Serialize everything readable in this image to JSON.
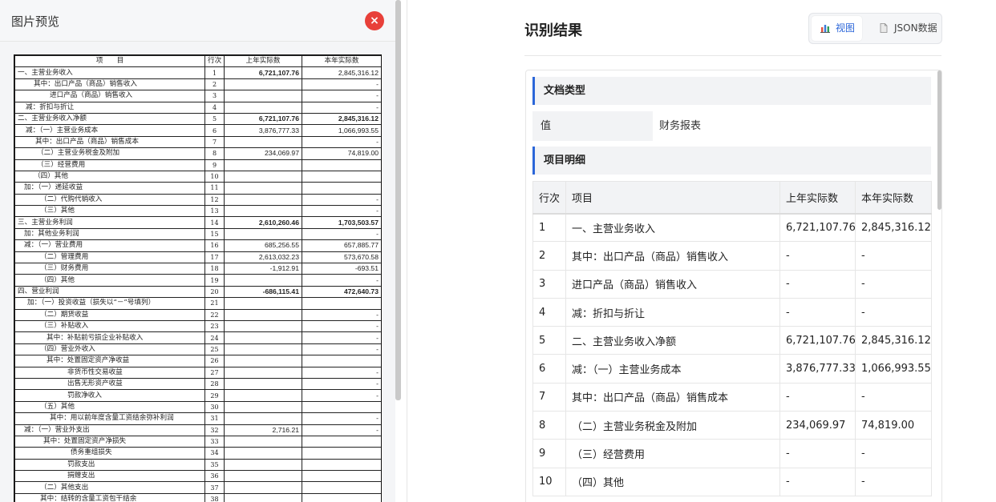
{
  "left": {
    "title": "图片预览",
    "close_glyph": "×"
  },
  "doc": {
    "headers": [
      "项　　目",
      "行次",
      "上年实际数",
      "本年实际数"
    ],
    "rows": [
      {
        "item": "一、主营业务收入",
        "no": "1",
        "prev": "6,721,107.76",
        "cur": "2,845,316.12",
        "bold_prev": true,
        "bold_cur": false,
        "indent": 0
      },
      {
        "item": "其中：出口产品（商品）销售收入",
        "no": "2",
        "prev": "",
        "cur": "-",
        "indent": 20
      },
      {
        "item": "进口产品（商品）销售收入",
        "no": "3",
        "prev": "",
        "cur": "-",
        "indent": 40
      },
      {
        "item": "减：折扣与折让",
        "no": "4",
        "prev": "",
        "cur": "-",
        "indent": 10
      },
      {
        "item": "二、主营业务收入净额",
        "no": "5",
        "prev": "6,721,107.76",
        "cur": "2,845,316.12",
        "bold_prev": true,
        "bold_cur": true,
        "indent": 0
      },
      {
        "item": "减：（一）主营业务成本",
        "no": "6",
        "prev": "3,876,777.33",
        "cur": "1,066,993.55",
        "indent": 10
      },
      {
        "item": "其中：出口产品（商品）销售成本",
        "no": "7",
        "prev": "",
        "cur": "-",
        "indent": 22
      },
      {
        "item": "（二）主营业务税金及附加",
        "no": "8",
        "prev": "234,069.97",
        "cur": "74,819.00",
        "indent": 24
      },
      {
        "item": "（三）经营费用",
        "no": "9",
        "prev": "",
        "cur": "",
        "indent": 24
      },
      {
        "item": "（四）其他",
        "no": "10",
        "prev": "",
        "cur": "",
        "indent": 20
      },
      {
        "item": "加：（一）递延收益",
        "no": "11",
        "prev": "",
        "cur": "",
        "indent": 8
      },
      {
        "item": "（二）代购代销收入",
        "no": "12",
        "prev": "",
        "cur": "-",
        "indent": 28
      },
      {
        "item": "（三）其他",
        "no": "13",
        "prev": "",
        "cur": "-",
        "indent": 28
      },
      {
        "item": "三、主营业务利润",
        "no": "14",
        "prev": "2,610,260.46",
        "cur": "1,703,503.57",
        "bold_prev": true,
        "bold_cur": true,
        "indent": 0
      },
      {
        "item": "加：其他业务利润",
        "no": "15",
        "prev": "",
        "cur": "-",
        "indent": 8
      },
      {
        "item": "减：（一）营业费用",
        "no": "16",
        "prev": "685,256.55",
        "cur": "657,885.77",
        "indent": 8
      },
      {
        "item": "（二）管理费用",
        "no": "17",
        "prev": "2,613,032.23",
        "cur": "573,670.58",
        "indent": 28
      },
      {
        "item": "（三）财务费用",
        "no": "18",
        "prev": "-1,912.91",
        "cur": "-693.51",
        "indent": 28
      },
      {
        "item": "（四）其他",
        "no": "19",
        "prev": "",
        "cur": "-",
        "indent": 28
      },
      {
        "item": "四、营业利润",
        "no": "20",
        "prev": "-686,115.41",
        "cur": "472,640.73",
        "bold_prev": true,
        "bold_cur": true,
        "indent": 0
      },
      {
        "item": "加：（一）投资收益（损失以“－”号填列）",
        "no": "21",
        "prev": "",
        "cur": "",
        "indent": 12
      },
      {
        "item": "（二）期货收益",
        "no": "22",
        "prev": "",
        "cur": "-",
        "indent": 28
      },
      {
        "item": "（三）补贴收入",
        "no": "23",
        "prev": "",
        "cur": "-",
        "indent": 28
      },
      {
        "item": "其中：补贴前亏损企业补贴收入",
        "no": "24",
        "prev": "",
        "cur": "-",
        "indent": 36
      },
      {
        "item": "（四）营业外收入",
        "no": "25",
        "prev": "",
        "cur": "-",
        "indent": 28
      },
      {
        "item": "其中：处置固定资产净收益",
        "no": "26",
        "prev": "",
        "cur": "",
        "indent": 36
      },
      {
        "item": "非货币性交易收益",
        "no": "27",
        "prev": "",
        "cur": "-",
        "indent": 62
      },
      {
        "item": "出售无形资产收益",
        "no": "28",
        "prev": "",
        "cur": "-",
        "indent": 62
      },
      {
        "item": "罚款净收入",
        "no": "29",
        "prev": "",
        "cur": "-",
        "indent": 62
      },
      {
        "item": "（五）其他",
        "no": "30",
        "prev": "",
        "cur": "",
        "indent": 28
      },
      {
        "item": "其中：用以前年度含量工资结余弥补利润",
        "no": "31",
        "prev": "",
        "cur": "-",
        "indent": 40
      },
      {
        "item": "减：（一）营业外支出",
        "no": "32",
        "prev": "2,716.21",
        "cur": "-",
        "indent": 8
      },
      {
        "item": "其中：处置固定资产净损失",
        "no": "33",
        "prev": "",
        "cur": "",
        "indent": 32
      },
      {
        "item": "债务重组损失",
        "no": "34",
        "prev": "",
        "cur": "",
        "indent": 66
      },
      {
        "item": "罚款支出",
        "no": "35",
        "prev": "",
        "cur": "",
        "indent": 62
      },
      {
        "item": "捐赠支出",
        "no": "36",
        "prev": "",
        "cur": "",
        "indent": 62
      },
      {
        "item": "（二）其他支出",
        "no": "37",
        "prev": "",
        "cur": "",
        "indent": 28
      },
      {
        "item": "其中：结转的含量工资包干结余",
        "no": "38",
        "prev": "",
        "cur": "",
        "indent": 28
      }
    ]
  },
  "right": {
    "title": "识别结果",
    "tab_view": "视图",
    "tab_json": "JSON数据",
    "accent": "#2b66d9",
    "doc_type_section": "文档类型",
    "doc_type_key": "值",
    "doc_type_value": "财务报表",
    "items_section": "项目明细",
    "columns": [
      "行次",
      "项目",
      "上年实际数",
      "本年实际数"
    ],
    "rows": [
      [
        "1",
        "一、主营业务收入",
        "6,721,107.76",
        "2,845,316.12"
      ],
      [
        "2",
        "其中：出口产品（商品）销售收入",
        "-",
        "-"
      ],
      [
        "3",
        "进口产品（商品）销售收入",
        "-",
        "-"
      ],
      [
        "4",
        "减：折扣与折让",
        "-",
        "-"
      ],
      [
        "5",
        "二、主营业务收入净额",
        "6,721,107.76",
        "2,845,316.12"
      ],
      [
        "6",
        "减：（一）主营业务成本",
        "3,876,777.33",
        "1,066,993.55"
      ],
      [
        "7",
        "其中：出口产品（商品）销售成本",
        "-",
        "-"
      ],
      [
        "8",
        "（二）主营业务税金及附加",
        "234,069.97",
        "74,819.00"
      ],
      [
        "9",
        "（三）经营费用",
        "-",
        "-"
      ],
      [
        "10",
        "（四）其他",
        "-",
        "-"
      ]
    ]
  }
}
